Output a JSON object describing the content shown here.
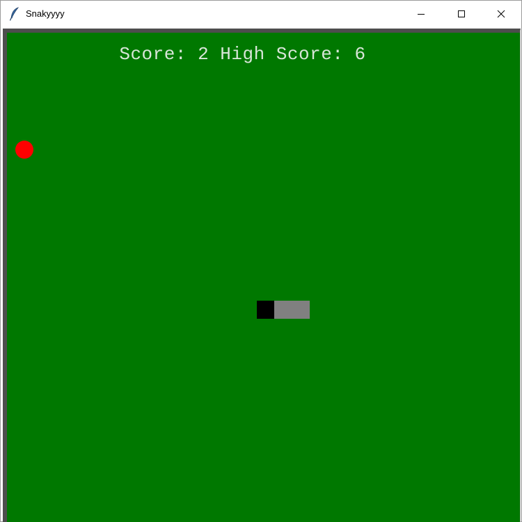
{
  "window": {
    "title": "Snakyyyy",
    "icon": "feather-icon"
  },
  "game": {
    "score_label": "Score:",
    "score": 2,
    "high_score_label": "High Score:",
    "high_score": 6,
    "colors": {
      "background": "#007800",
      "food": "#ff0000",
      "snake_head": "#000000",
      "snake_body": "#808080",
      "score_text": "#d8e6d8"
    },
    "snake_length": 3
  }
}
